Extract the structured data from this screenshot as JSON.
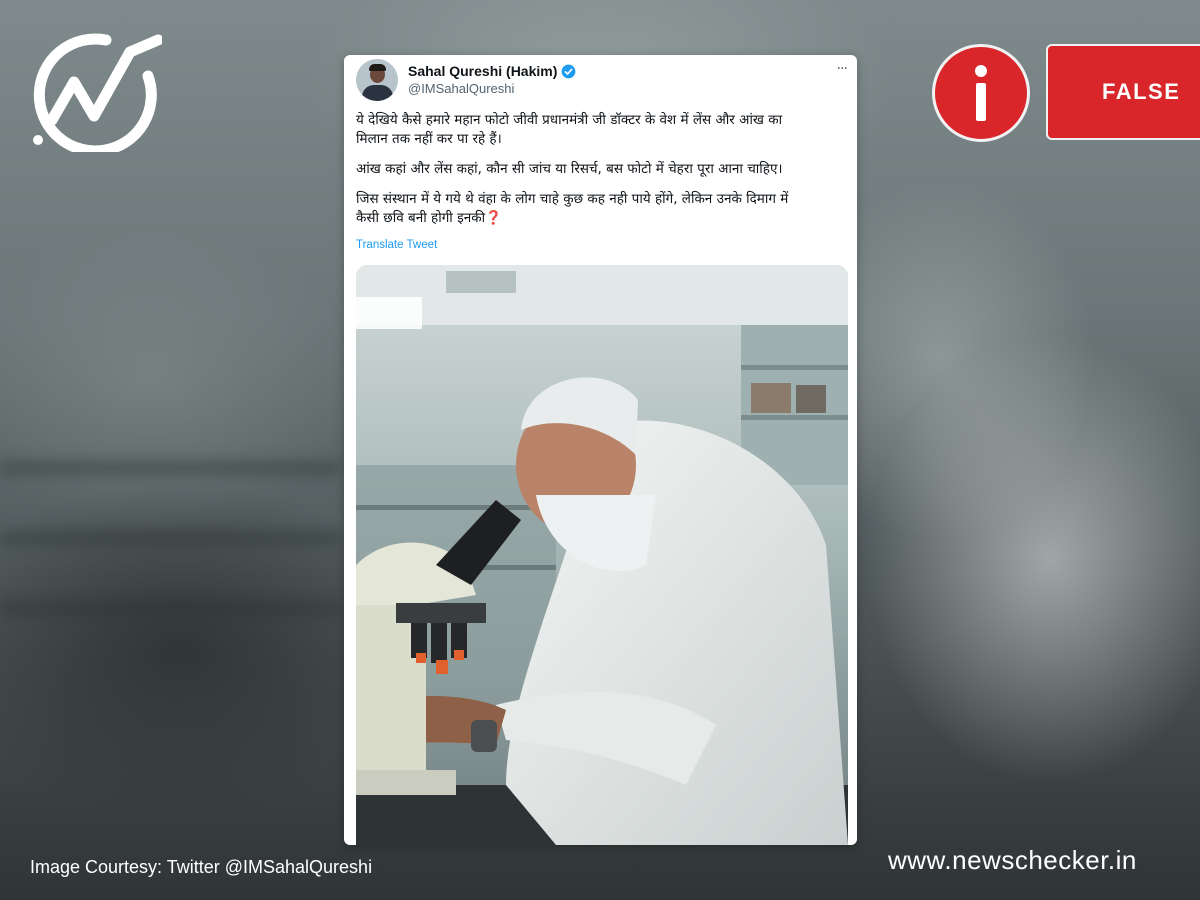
{
  "branding": {
    "logo_icon": "newschecker-check-icon",
    "site": "www.newschecker.in",
    "brand_red": "#d8262a"
  },
  "verdict": {
    "icon": "info-icon",
    "label": "FALSE"
  },
  "tweet": {
    "name": "Sahal Qureshi (Hakim)",
    "verified_icon": "verified-badge-icon",
    "handle": "@IMSahalQureshi",
    "more_icon": "more-options-icon",
    "more_glyph": "···",
    "paragraphs": [
      "ये देखिये कैसे हमारे महान फोटो जीवी प्रधानमंत्री जी डॉक्टर के वेश में लेंस और आंख का\nमिलान तक नहीं कर पा रहे हैं।",
      "आंख कहां और लेंस कहां, कौन सी जांच या रिसर्च, बस फोटो में चेहरा पूरा आना चाहिए।",
      "जिस संस्थान में ये गये थे वंहा के लोग चाहे कुछ कह नही पाये होंगे, लेकिन उनके दिमाग में\nकैसी छवि बनी होगी इनकी"
    ],
    "question_mark": "❓",
    "translate_link": "Translate Tweet",
    "image_description_icon": "tweet-photo"
  },
  "footer": {
    "courtesy": "Image Courtesy: Twitter @IMSahalQureshi"
  }
}
